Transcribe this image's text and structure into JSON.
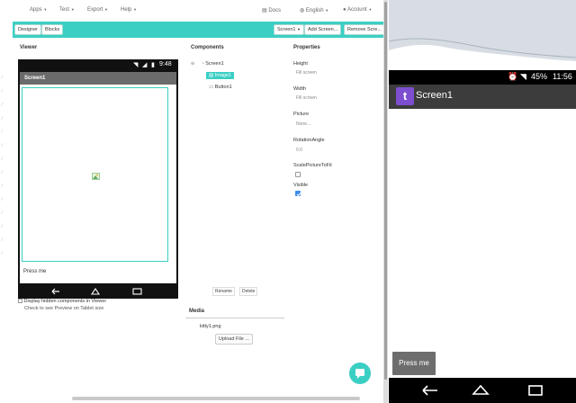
{
  "menus": [
    "Apps",
    "Test",
    "Export",
    "Help"
  ],
  "topright": {
    "docs": "Docs",
    "language": "English",
    "account": "Account"
  },
  "toolbar": {
    "designer": "Designer",
    "blocks": "Blocks",
    "screen_select": "Screen1",
    "add_screen": "Add Screen...",
    "remove_screen": "Remove Scre..."
  },
  "viewer": {
    "heading": "Viewer",
    "time": "9:48",
    "screen_title": "Screen1",
    "button_text": "Press me",
    "checkbox_label": "Display hidden components in Viewer",
    "preview_note": "Check to see Preview on Tablet size"
  },
  "components": {
    "heading": "Components",
    "tree": [
      "Screen1",
      "Image1",
      "Button1"
    ],
    "rename": "Rename",
    "delete": "Delete"
  },
  "media": {
    "heading": "Media",
    "file": "kitty1.png",
    "upload": "Upload File ..."
  },
  "properties": {
    "heading": "Properties",
    "items": [
      {
        "label": "Height",
        "value": "Fill screen"
      },
      {
        "label": "Width",
        "value": "Fill screen"
      },
      {
        "label": "Picture",
        "value": "None..."
      },
      {
        "label": "RotationAngle",
        "value": "0.0"
      },
      {
        "label": "ScalePictureToFit",
        "value": ""
      },
      {
        "label": "Visible",
        "value": ""
      }
    ],
    "scale_checked": false,
    "visible_checked": true
  },
  "emulator": {
    "battery": "45%",
    "time": "11:56",
    "title": "Screen1",
    "logo": "t",
    "button_text": "Press me"
  },
  "colors": {
    "accent": "#3bcfc4",
    "emulator_action": "#3c3c3c",
    "emulator_logo": "#7d4fd0"
  }
}
